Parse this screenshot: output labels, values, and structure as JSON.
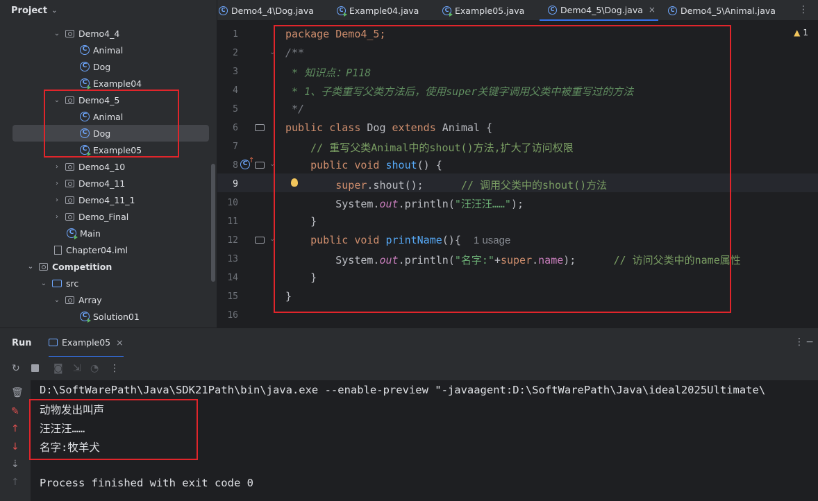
{
  "project_panel": {
    "title": "Project",
    "tree": [
      {
        "label": "Demo4_4",
        "type": "folder",
        "expanded": true
      },
      {
        "label": "Animal",
        "type": "class"
      },
      {
        "label": "Dog",
        "type": "class"
      },
      {
        "label": "Example04",
        "type": "runclass"
      },
      {
        "label": "Demo4_5",
        "type": "folder",
        "expanded": true
      },
      {
        "label": "Animal",
        "type": "class"
      },
      {
        "label": "Dog",
        "type": "class",
        "selected": true
      },
      {
        "label": "Example05",
        "type": "runclass"
      },
      {
        "label": "Demo4_10",
        "type": "folder",
        "expanded": false
      },
      {
        "label": "Demo4_11",
        "type": "folder",
        "expanded": false
      },
      {
        "label": "Demo4_11_1",
        "type": "folder",
        "expanded": false
      },
      {
        "label": "Demo_Final",
        "type": "folder",
        "expanded": false
      },
      {
        "label": "Main",
        "type": "runclass"
      },
      {
        "label": "Chapter04.iml",
        "type": "iml"
      },
      {
        "label": "Competition",
        "type": "module",
        "expanded": true
      },
      {
        "label": "src",
        "type": "src",
        "expanded": true
      },
      {
        "label": "Array",
        "type": "folder",
        "expanded": true
      },
      {
        "label": "Solution01",
        "type": "runclass"
      }
    ]
  },
  "tabs": [
    {
      "label": "Demo4_4\\Dog.java",
      "active": false
    },
    {
      "label": "Example04.java",
      "active": false
    },
    {
      "label": "Example05.java",
      "active": false
    },
    {
      "label": "Demo4_5\\Dog.java",
      "active": true
    },
    {
      "label": "Demo4_5\\Animal.java",
      "active": false
    }
  ],
  "editor": {
    "warning_count": "1",
    "line_numbers": [
      "1",
      "2",
      "3",
      "4",
      "5",
      "6",
      "7",
      "8",
      "9",
      "10",
      "11",
      "12",
      "13",
      "14",
      "15",
      "16"
    ],
    "current_line": 9,
    "usage_hint": "1 usage",
    "code": {
      "l1": "package Demo4_5;",
      "l2": "/**",
      "l3": " * 知识点：P118",
      "l4": " * 1、子类重写父类方法后，使用super关键字调用父类中被重写过的方法",
      "l5": " */",
      "l6_kw": "public class ",
      "l6_name": "Dog ",
      "l6_kw2": "extends ",
      "l6_super": "Animal {",
      "l7": "    // 重写父类Animal中的shout()方法,扩大了访问权限",
      "l8_kw": "    public void ",
      "l8_fn": "shout",
      "l8_rest": "() {",
      "l9_kw": "        super",
      "l9_rest": ".shout();",
      "l9_cm": "      // 调用父类中的shout()方法",
      "l10_a": "        System.",
      "l10_out": "out",
      "l10_b": ".println(",
      "l10_str": "\"汪汪汪……\"",
      "l10_c": ");",
      "l11": "    }",
      "l12_kw": "    public void ",
      "l12_fn": "printName",
      "l12_rest": "(){",
      "l13_a": "        System.",
      "l13_out": "out",
      "l13_b": ".println(",
      "l13_str": "\"名字:\"",
      "l13_plus": "+",
      "l13_kw": "super",
      "l13_dot": ".",
      "l13_fld": "name",
      "l13_c": ");",
      "l13_cm": "      // 访问父类中的name属性",
      "l14": "    }",
      "l15": "}"
    }
  },
  "run_panel": {
    "title": "Run",
    "tab_label": "Example05",
    "console": [
      "D:\\SoftWarePath\\Java\\SDK21Path\\bin\\java.exe --enable-preview \"-javaagent:D:\\SoftWarePath\\Java\\ideal2025Ultimate\\",
      "动物发出叫声",
      "汪汪汪……",
      "名字:牧羊犬",
      "",
      "Process finished with exit code 0"
    ]
  }
}
